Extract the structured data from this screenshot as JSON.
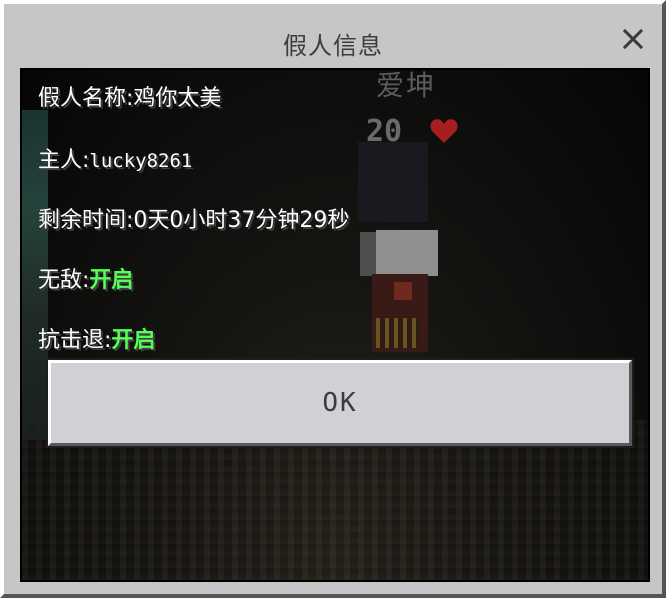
{
  "dialog": {
    "title": "假人信息",
    "close_icon": "close-icon"
  },
  "world": {
    "nametag": "爱坤",
    "health": "20",
    "heart_icon": "heart-icon",
    "heart_color": "#d22b2b"
  },
  "info": {
    "name_label": "假人名称:",
    "name_value": "鸡你太美",
    "owner_label": "主人:",
    "owner_value": "lucky8261",
    "time_label": "剩余时间:",
    "time_value": "0天0小时37分钟29秒",
    "invincible_label": "无敌:",
    "invincible_value": "开启",
    "knockback_label": "抗击退:",
    "knockback_value": "开启",
    "enabled_color": "#55ff55"
  },
  "buttons": {
    "ok_label": "OK"
  }
}
